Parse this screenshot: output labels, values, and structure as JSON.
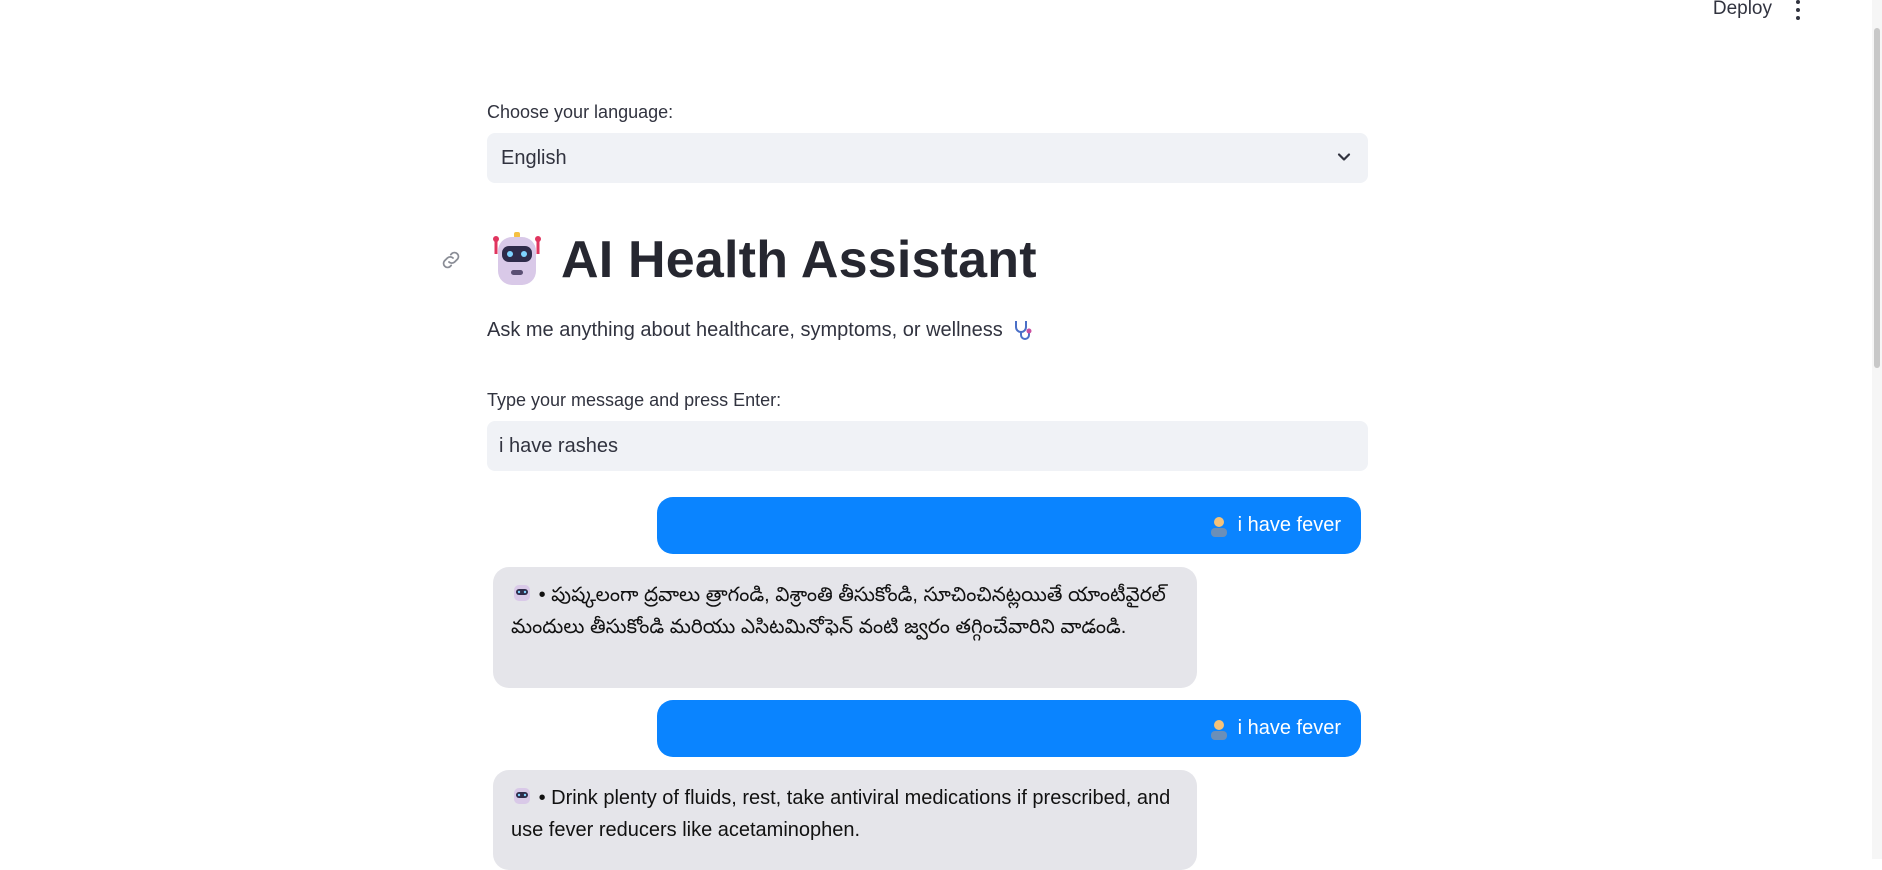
{
  "header": {
    "deploy_label": "Deploy"
  },
  "language": {
    "label": "Choose your language:",
    "selected": "English"
  },
  "title": "AI Health Assistant",
  "subtitle": "Ask me anything about healthcare, symptoms, or wellness",
  "input": {
    "label": "Type your message and press Enter:",
    "value": "i have rashes"
  },
  "chat": [
    {
      "role": "user",
      "text": "i have fever"
    },
    {
      "role": "bot",
      "text": "• పుష్కలంగా ద్రవాలు త్రాగండి, విశ్రాంతి తీసుకోండి, సూచించినట్లయితే యాంటీవైరల్ మందులు తీసుకోండి మరియు ఎసిటమినోఫెన్ వంటి జ్వరం తగ్గించేవారిని వాడండి."
    },
    {
      "role": "user",
      "text": "i have fever"
    },
    {
      "role": "bot",
      "text": "• Drink plenty of fluids, rest, take antiviral medications if prescribed, and use fever reducers like acetaminophen."
    }
  ],
  "colors": {
    "user_bubble": "#0a84ff",
    "bot_bubble": "#e5e5ea",
    "input_bg": "#f0f2f6"
  },
  "icons": [
    "link-icon",
    "robot-icon",
    "stethoscope-icon",
    "user-icon",
    "chevron-down-icon",
    "kebab-menu-icon"
  ]
}
